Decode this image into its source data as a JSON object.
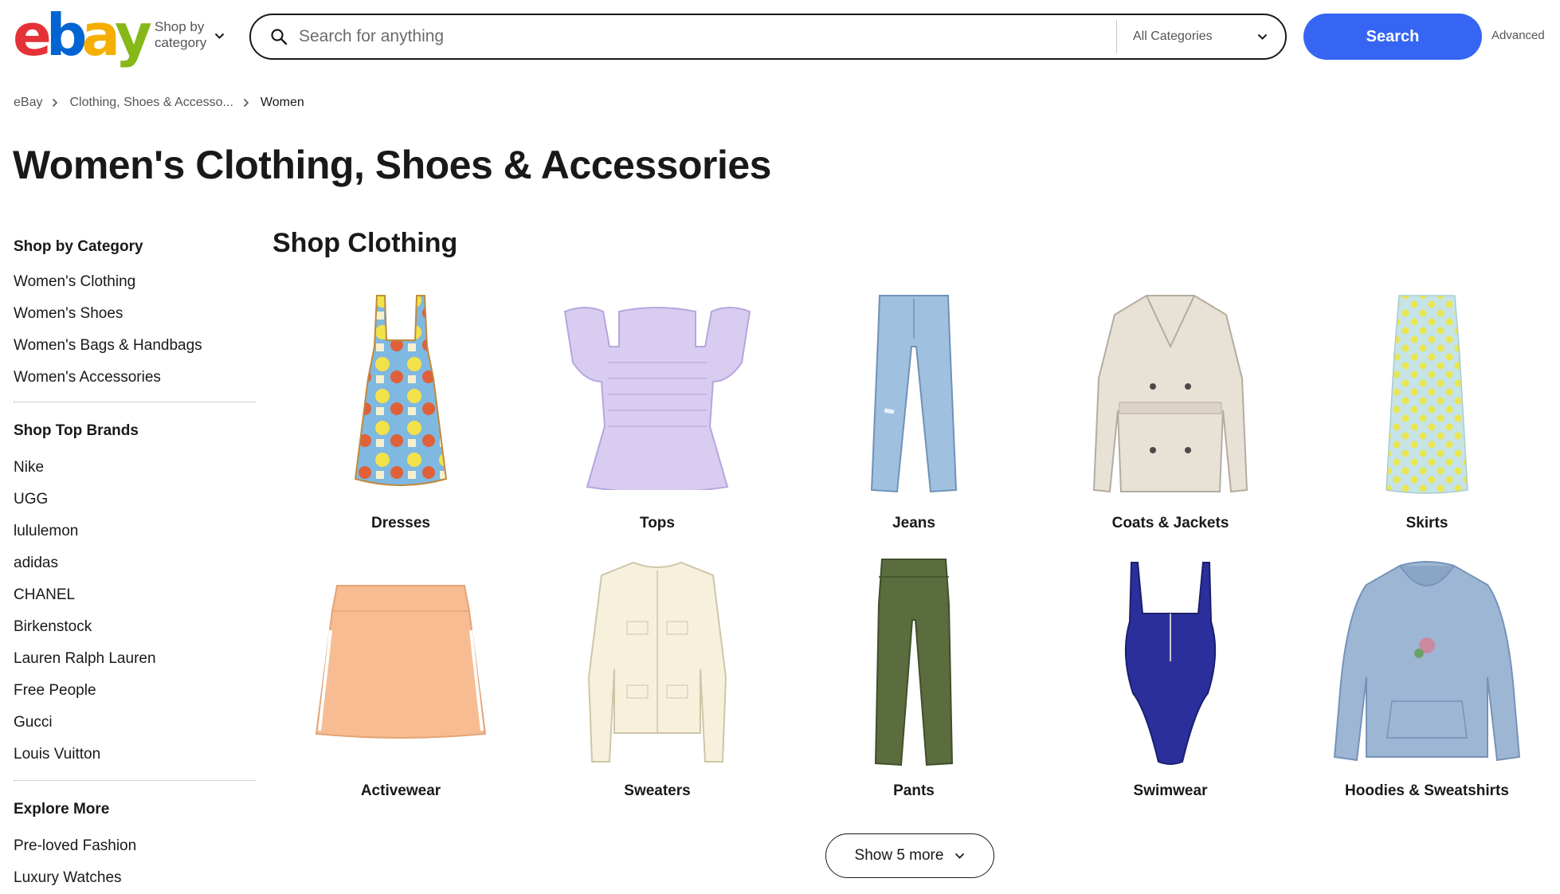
{
  "header": {
    "logo_letters": [
      "e",
      "b",
      "a",
      "y"
    ],
    "logo_colors": [
      "#e53238",
      "#0064d2",
      "#f5af02",
      "#86b817"
    ],
    "shop_by_line1": "Shop by",
    "shop_by_line2": "category",
    "search_placeholder": "Search for anything",
    "search_value": "",
    "category_selected": "All Categories",
    "search_button": "Search",
    "advanced_link": "Advanced",
    "accent_color": "#3665f3"
  },
  "breadcrumb": [
    {
      "label": "eBay"
    },
    {
      "label": "Clothing, Shoes & Accesso..."
    },
    {
      "label": "Women"
    }
  ],
  "page_title": "Women's Clothing, Shoes & Accessories",
  "sidebar": {
    "sections": [
      {
        "heading": "Shop by Category",
        "items": [
          "Women's Clothing",
          "Women's Shoes",
          "Women's Bags & Handbags",
          "Women's Accessories"
        ]
      },
      {
        "heading": "Shop Top Brands",
        "items": [
          "Nike",
          "UGG",
          "lululemon",
          "adidas",
          "CHANEL",
          "Birkenstock",
          "Lauren Ralph Lauren",
          "Free People",
          "Gucci",
          "Louis Vuitton"
        ]
      },
      {
        "heading": "Explore More",
        "items": [
          "Pre-loved Fashion",
          "Luxury Watches"
        ]
      }
    ]
  },
  "main": {
    "section_title": "Shop Clothing",
    "categories": [
      {
        "label": "Dresses",
        "icon": "dress-image"
      },
      {
        "label": "Tops",
        "icon": "top-image"
      },
      {
        "label": "Jeans",
        "icon": "jeans-image"
      },
      {
        "label": "Coats & Jackets",
        "icon": "coat-image"
      },
      {
        "label": "Skirts",
        "icon": "skirt-image"
      },
      {
        "label": "Activewear",
        "icon": "activewear-image"
      },
      {
        "label": "Sweaters",
        "icon": "sweater-image"
      },
      {
        "label": "Pants",
        "icon": "pants-image"
      },
      {
        "label": "Swimwear",
        "icon": "swimsuit-image"
      },
      {
        "label": "Hoodies & Sweatshirts",
        "icon": "hoodie-image"
      }
    ],
    "show_more": "Show 5 more"
  }
}
